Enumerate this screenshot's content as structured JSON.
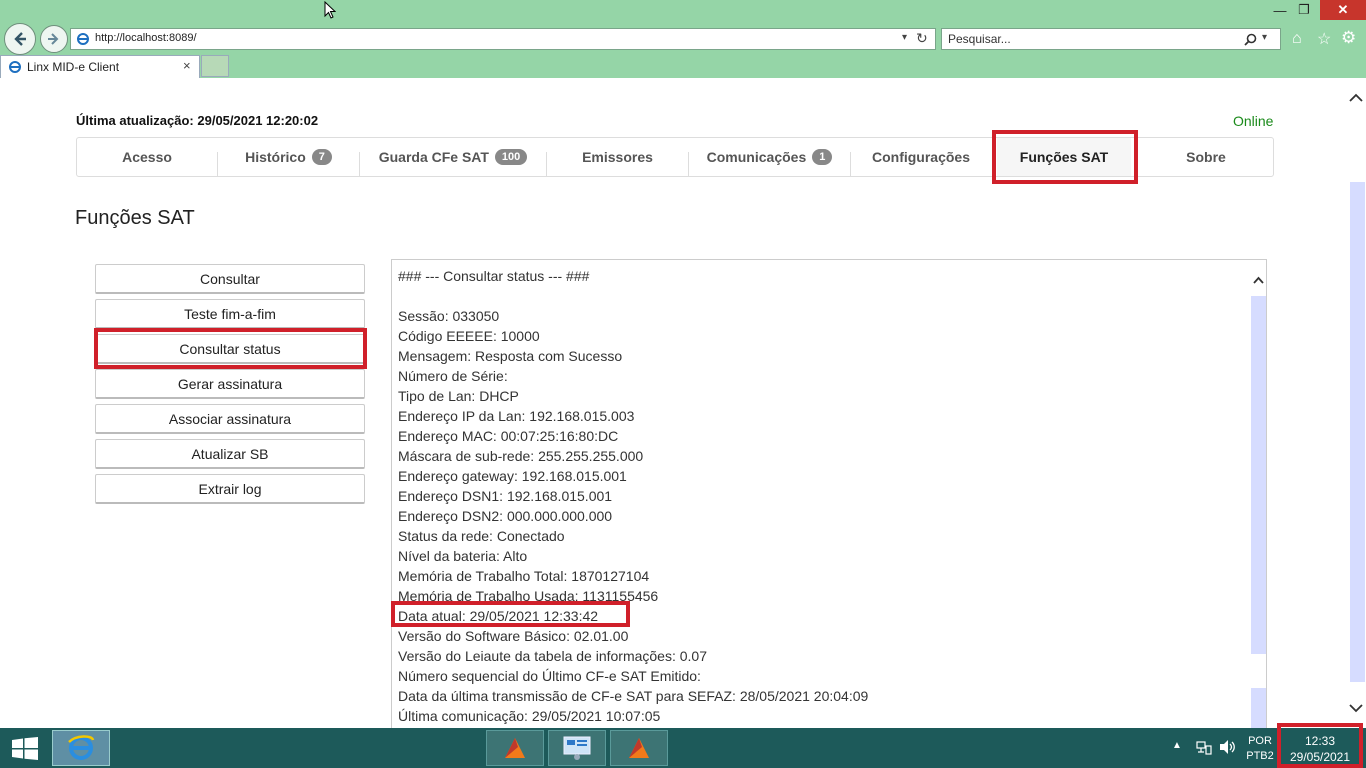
{
  "browser": {
    "address": "http://localhost:8089/",
    "search_placeholder": "Pesquisar...",
    "tab_title": "Linx MID-e Client"
  },
  "page": {
    "last_update": "Última atualização: 29/05/2021 12:20:02",
    "status": "Online",
    "title": "Funções SAT"
  },
  "nav_tabs": [
    {
      "label": "Acesso"
    },
    {
      "label": "Histórico",
      "badge": "7"
    },
    {
      "label": "Guarda CFe SAT",
      "badge": "100"
    },
    {
      "label": "Emissores"
    },
    {
      "label": "Comunicações",
      "badge": "1"
    },
    {
      "label": "Configurações"
    },
    {
      "label": "Funções SAT"
    },
    {
      "label": "Sobre"
    }
  ],
  "side_buttons": [
    "Consultar",
    "Teste fim-a-fim",
    "Consultar status",
    "Gerar assinatura",
    "Associar assinatura",
    "Atualizar SB",
    "Extrair log"
  ],
  "output_lines": [
    "### --- Consultar status --- ###",
    "",
    "Sessão: 033050",
    "Código EEEEE: 10000",
    "Mensagem: Resposta com Sucesso",
    "Número de Série:",
    "Tipo de Lan: DHCP",
    "Endereço IP da Lan: 192.168.015.003",
    "Endereço MAC: 00:07:25:16:80:DC",
    "Máscara de sub-rede: 255.255.255.000",
    "Endereço gateway: 192.168.015.001",
    "Endereço DSN1: 192.168.015.001",
    "Endereço DSN2: 000.000.000.000",
    "Status da rede: Conectado",
    "Nível da bateria: Alto",
    "Memória de Trabalho Total: 1870127104",
    "Memória de Trabalho Usada: 1131155456",
    "Data atual: 29/05/2021 12:33:42",
    "Versão do Software Básico: 02.01.00",
    "Versão do Leiaute da tabela de informações: 0.07",
    "Número sequencial do Último CF-e SAT Emitido:",
    "Data da última transmissão de CF-e SAT para SEFAZ: 28/05/2021 20:04:09",
    "Última comunicação: 29/05/2021 10:07:05"
  ],
  "taskbar": {
    "lang_top": "POR",
    "lang_bottom": "PTB2",
    "time": "12:33",
    "date": "29/05/2021"
  },
  "colors": {
    "chrome": "#95d5a7",
    "highlight": "#d0202a",
    "online": "#1a8a1a",
    "taskbar": "#1d5a5a"
  }
}
